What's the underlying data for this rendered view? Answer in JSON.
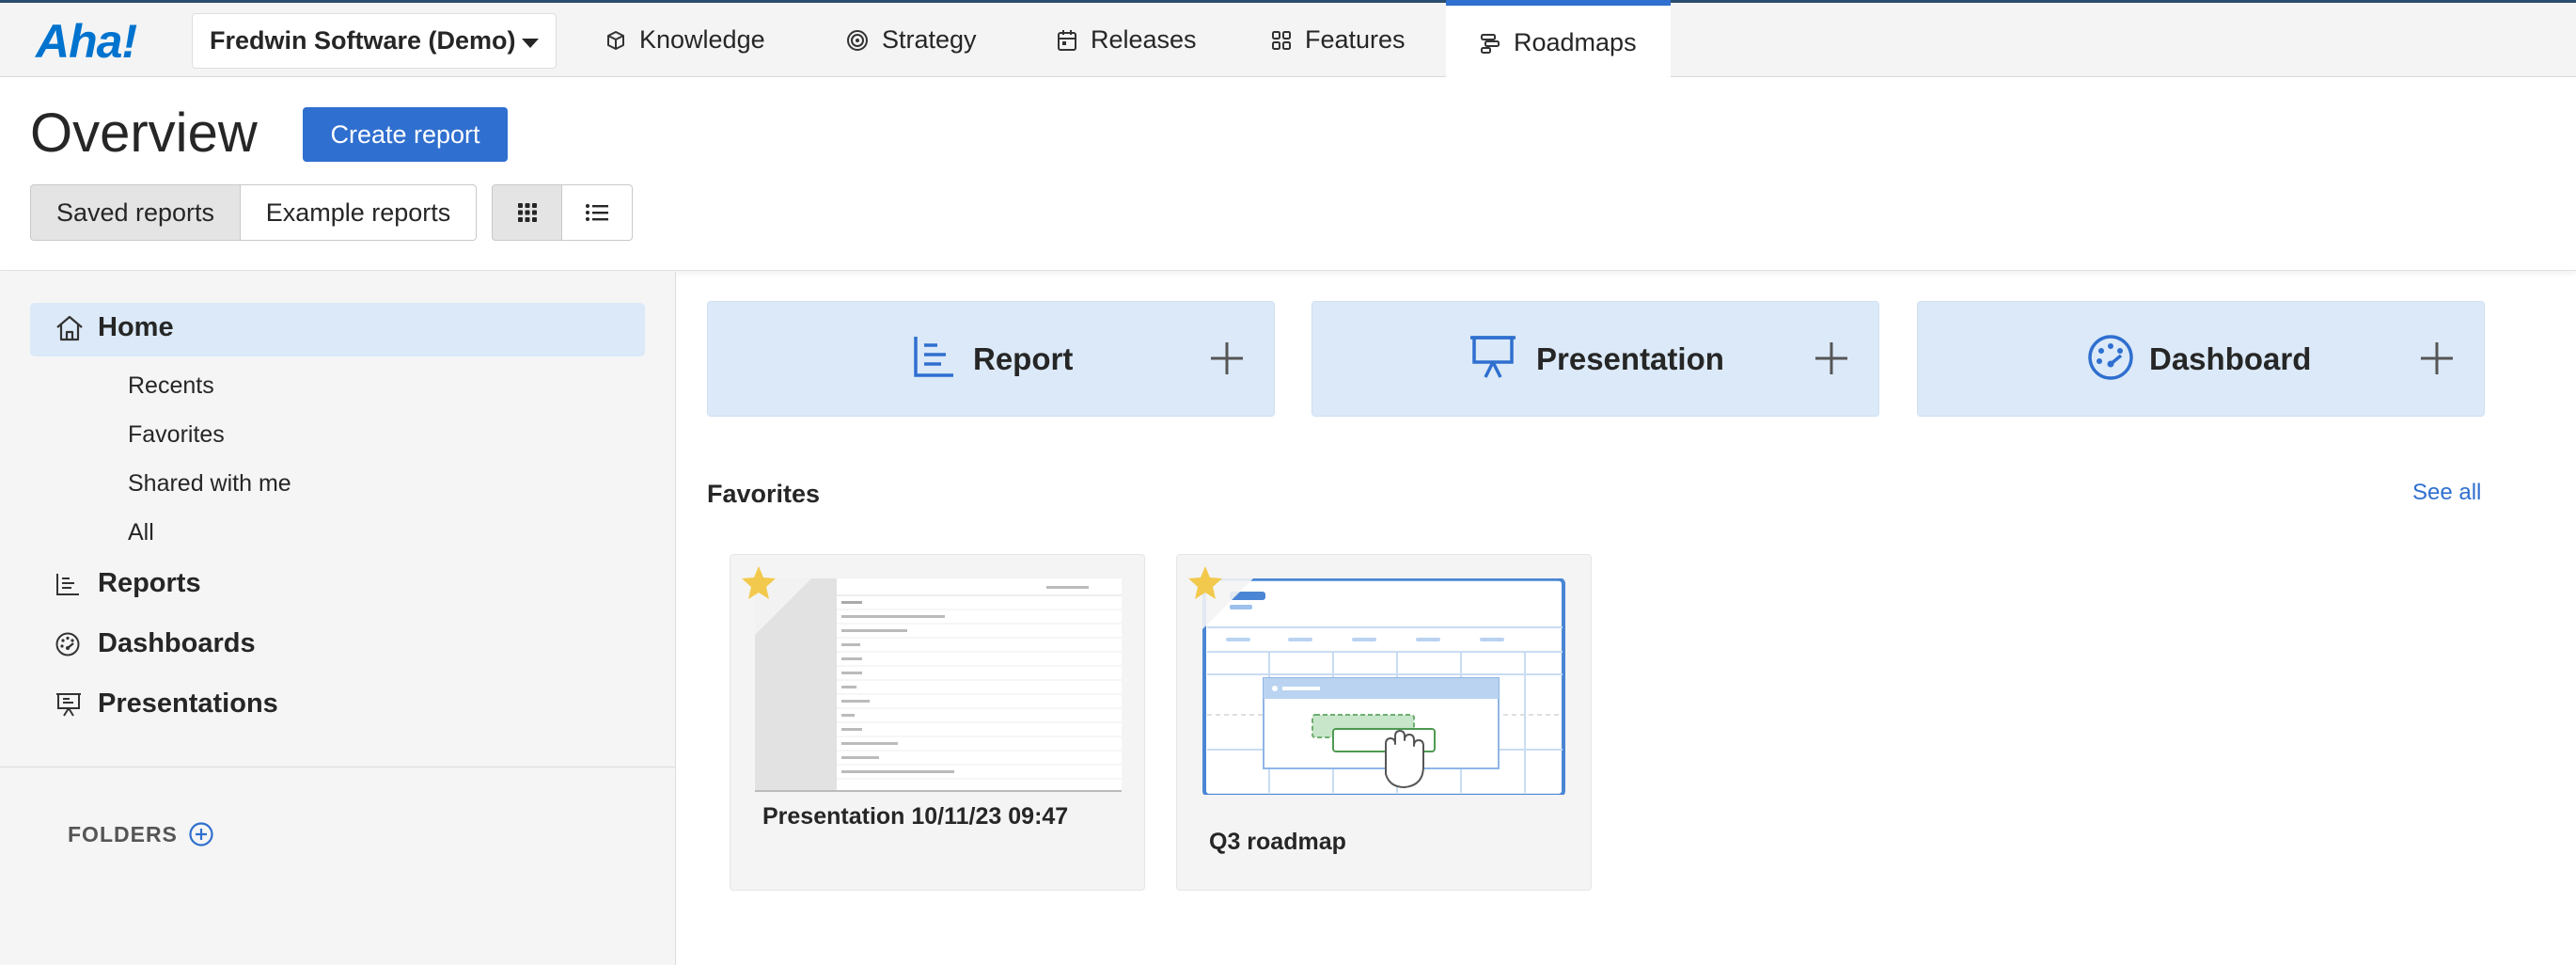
{
  "app": {
    "logo": "Aha!"
  },
  "nav": {
    "workspace": "Fredwin Software (Demo)",
    "tabs": [
      {
        "label": "Knowledge",
        "icon": "cube-icon"
      },
      {
        "label": "Strategy",
        "icon": "target-icon"
      },
      {
        "label": "Releases",
        "icon": "calendar-icon"
      },
      {
        "label": "Features",
        "icon": "grid-icon"
      },
      {
        "label": "Roadmaps",
        "icon": "roadmap-icon",
        "active": true
      }
    ]
  },
  "header": {
    "title": "Overview",
    "create_button": "Create report",
    "tabs": [
      {
        "label": "Saved reports",
        "selected": true
      },
      {
        "label": "Example reports",
        "selected": false
      }
    ],
    "view_toggles": [
      {
        "icon": "grid-view-icon",
        "selected": true
      },
      {
        "icon": "list-view-icon",
        "selected": false
      }
    ]
  },
  "sidebar": {
    "home": "Home",
    "sub_items": [
      "Recents",
      "Favorites",
      "Shared with me",
      "All"
    ],
    "items": [
      {
        "label": "Reports",
        "icon": "chart-icon"
      },
      {
        "label": "Dashboards",
        "icon": "dashboard-icon"
      },
      {
        "label": "Presentations",
        "icon": "presentation-icon"
      }
    ],
    "folders_label": "FOLDERS"
  },
  "quick_create": [
    {
      "label": "Report",
      "icon": "chart-icon"
    },
    {
      "label": "Presentation",
      "icon": "presentation-icon"
    },
    {
      "label": "Dashboard",
      "icon": "dashboard-icon"
    }
  ],
  "favorites": {
    "heading": "Favorites",
    "see_all": "See all",
    "cards": [
      {
        "title": "Presentation 10/11/23 09:47",
        "starred": true
      },
      {
        "title": "Q3 roadmap",
        "starred": true
      }
    ]
  },
  "colors": {
    "accent": "#2f6fcf",
    "tile_bg": "#dbe9f8",
    "logo": "#0073cf"
  }
}
